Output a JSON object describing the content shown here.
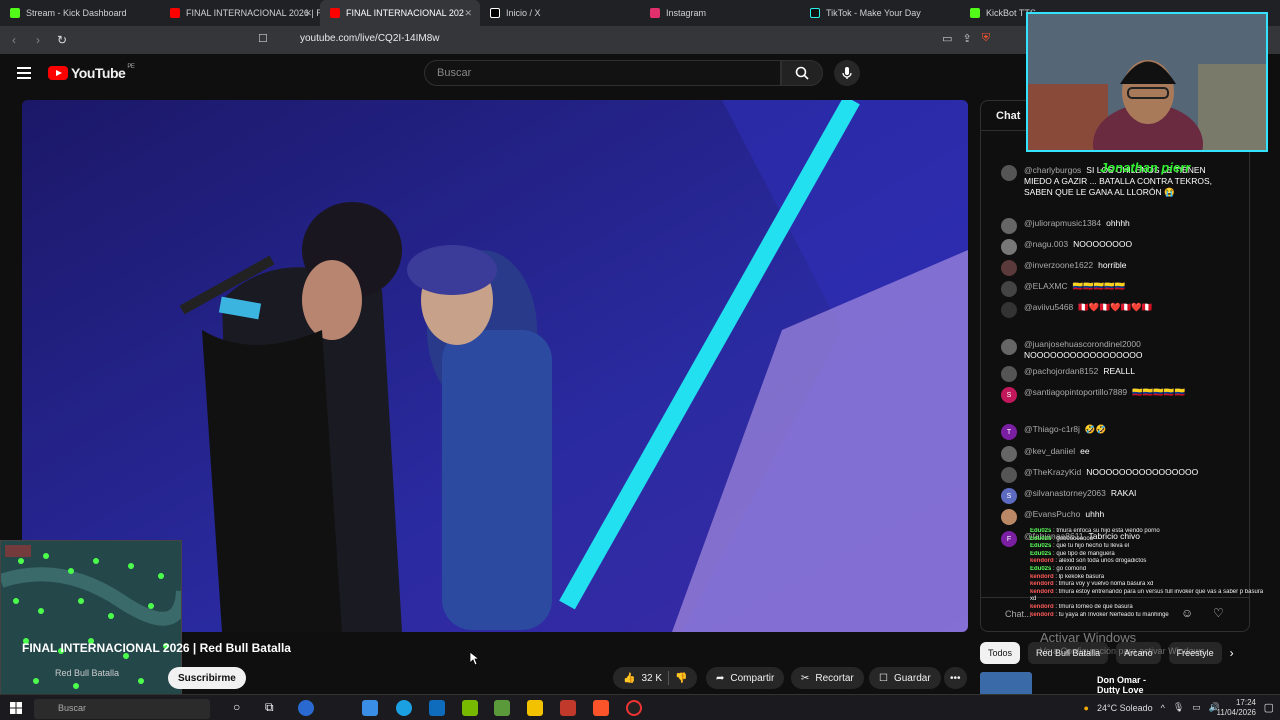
{
  "browser": {
    "tabs": [
      {
        "label": "Stream - Kick Dashboard",
        "color": "#53fc18"
      },
      {
        "label": "FINAL INTERNACIONAL 2026 | R",
        "color": "#ff0000"
      },
      {
        "label": "FINAL INTERNACIONAL 202",
        "color": "#ff0000",
        "active": true
      },
      {
        "label": "Inicio / X",
        "color": "#ffffff"
      },
      {
        "label": "Instagram",
        "color": "#e1306c"
      },
      {
        "label": "TikTok - Make Your Day",
        "color": "#25f4ee"
      },
      {
        "label": "KickBot TTS",
        "color": "#53fc18"
      }
    ],
    "url": "youtube.com/live/CQ2I-14IM8w"
  },
  "youtube": {
    "logo": "YouTube",
    "country": "PE",
    "search_placeholder": "Buscar"
  },
  "video": {
    "title": "FINAL INTERNACIONAL 2026 | Red Bull Batalla",
    "channel": "Red Bull Batalla",
    "subscribe": "Suscribirme",
    "likes": "32 K",
    "share": "Compartir",
    "clip": "Recortar",
    "save": "Guardar"
  },
  "chat": {
    "header": "Chat",
    "input_placeholder": "Chat...",
    "messages": [
      {
        "author": "@charlyburgos",
        "text": "SI LOS CHILENOS LE TIENEN MIEDO A GAZIR ... BATALLA CONTRA TEKROS, SABEN QUE LE GANA AL LLORÓN 😭",
        "avatar_color": "#555"
      },
      {
        "author": "@juliorapmusic1384",
        "text": "ohhhh",
        "avatar_color": "#666"
      },
      {
        "author": "@nagu.003",
        "text": "NOOOOOOOO",
        "avatar_color": "#777"
      },
      {
        "author": "@inverzoone1622",
        "text": "horrible",
        "avatar_color": "#5a3a3a"
      },
      {
        "author": "@ELAXMC",
        "text": "🇨🇴🇨🇴🇨🇴🇨🇴🇨🇴",
        "avatar_color": "#444"
      },
      {
        "author": "@aviivu5468",
        "text": "🇵🇪❤️🇵🇪❤️🇵🇪❤️🇵🇪",
        "avatar_color": "#333"
      },
      {
        "author": "@juanjosehuascorondinel2000",
        "text": "NOOOOOOOOOOOOOOOOO",
        "avatar_color": "#666"
      },
      {
        "author": "@pachojordan8152",
        "text": "REALLL",
        "avatar_color": "#555"
      },
      {
        "author": "@santiagopintoportillo7889",
        "text": "🇨🇴🇨🇴🇨🇴🇨🇴🇨🇴",
        "avatar_color": "#c2185b",
        "initial": "S"
      },
      {
        "author": "@Thiago-c1r8j",
        "text": "🤣🤣",
        "avatar_color": "#7b1fa2",
        "initial": "T"
      },
      {
        "author": "@kev_daniiel",
        "text": "ee",
        "avatar_color": "#666"
      },
      {
        "author": "@TheKrazyKid",
        "text": "NOOOOOOOOOOOOOOOO",
        "avatar_color": "#555"
      },
      {
        "author": "@silvanastorney2063",
        "text": "RAKAI",
        "avatar_color": "#5c6bc0",
        "initial": "S"
      },
      {
        "author": "@EvansPucho",
        "text": "uhhh",
        "avatar_color": "#bb8866"
      },
      {
        "author": "@fabianaa8611",
        "text": "Tabricio chivo",
        "avatar_color": "#7b1fa2",
        "initial": "F"
      }
    ]
  },
  "chips": [
    "Todos",
    "Red Bull Batalla",
    "Arcano",
    "Freestyle"
  ],
  "upnext": "Don Omar - Dutty Love (Lyric",
  "overlay": {
    "webcam_name": "Jonathan pierr",
    "kick_lines": [
      {
        "user": "Edu02s",
        "text": "tmura enfoca su hijo esta viendo porno",
        "color": "g"
      },
      {
        "user": "Edu02s",
        "text": "goooooooooo",
        "color": "g"
      },
      {
        "user": "Edu02s",
        "text": "que tu hijo hecho tu lleva el",
        "color": "g"
      },
      {
        "user": "Edu02s",
        "text": "que tipo de manguera",
        "color": "g"
      },
      {
        "user": "kendord",
        "text": "alexid son toda unos drogadictos",
        "color": "n"
      },
      {
        "user": "Edu02s",
        "text": "go comond",
        "color": "g"
      },
      {
        "user": "kendord",
        "text": "lp kekoke basura",
        "color": "n"
      },
      {
        "user": "kendord",
        "text": "tmura voy y vuelvo noma basura xd",
        "color": "n"
      },
      {
        "user": "kendord",
        "text": "tmura estoy entrenando para un versus full invoker que vas a saber p basura xd",
        "color": "n"
      },
      {
        "user": "kendord",
        "text": "tmura torneo de que basura",
        "color": "n"
      },
      {
        "user": "kendord",
        "text": "tu yaya ah Invoker Nerfeado tu manhinge",
        "color": "n"
      }
    ],
    "activate_title": "Activar Windows",
    "activate_sub": "Ve a Configuración para activar Windows."
  },
  "taskbar": {
    "search": "Buscar",
    "weather": "24°C Soleado",
    "time": "17:24",
    "date": "11/04/2026"
  }
}
